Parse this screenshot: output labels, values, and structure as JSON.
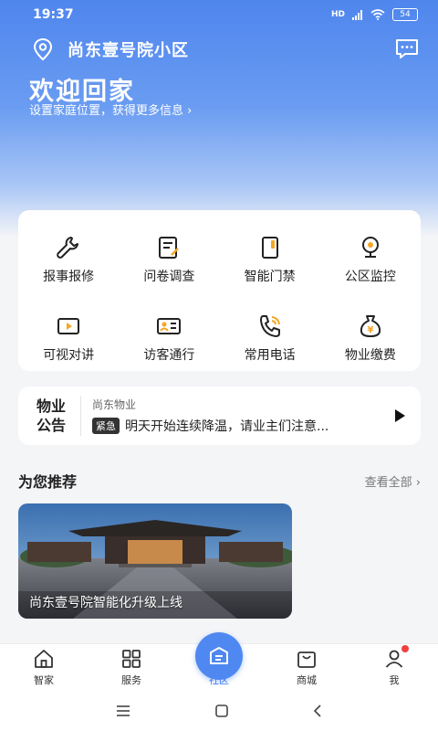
{
  "status_bar": {
    "time": "19:37",
    "network": "HD",
    "battery": "54"
  },
  "header": {
    "community_name": "尚东壹号院小区"
  },
  "welcome": {
    "title": "欢迎回家",
    "subtitle": "设置家庭位置，获得更多信息 ›"
  },
  "services": [
    {
      "label": "报事报修",
      "icon": "wrench-icon"
    },
    {
      "label": "问卷调查",
      "icon": "survey-icon"
    },
    {
      "label": "智能门禁",
      "icon": "door-icon"
    },
    {
      "label": "公区监控",
      "icon": "camera-icon"
    },
    {
      "label": "可视对讲",
      "icon": "video-icon"
    },
    {
      "label": "访客通行",
      "icon": "id-card-icon"
    },
    {
      "label": "常用电话",
      "icon": "phone-icon"
    },
    {
      "label": "物业缴费",
      "icon": "money-bag-icon"
    }
  ],
  "notice": {
    "title_line1": "物业",
    "title_line2": "公告",
    "source": "尚东物业",
    "badge": "紧急",
    "text": "明天开始连续降温，请业主们注意..."
  },
  "recommend": {
    "title": "为您推荐",
    "more": "查看全部 ›",
    "items": [
      {
        "caption": "尚东壹号院智能化升级上线"
      }
    ]
  },
  "tabs": [
    {
      "label": "智家",
      "icon": "home-icon"
    },
    {
      "label": "服务",
      "icon": "grid-icon"
    },
    {
      "label": "社区",
      "icon": "community-icon"
    },
    {
      "label": "商城",
      "icon": "shop-bag-icon"
    },
    {
      "label": "我",
      "icon": "person-icon"
    }
  ],
  "colors": {
    "accent": "#4f88f0",
    "badge_dot": "#f04040"
  }
}
